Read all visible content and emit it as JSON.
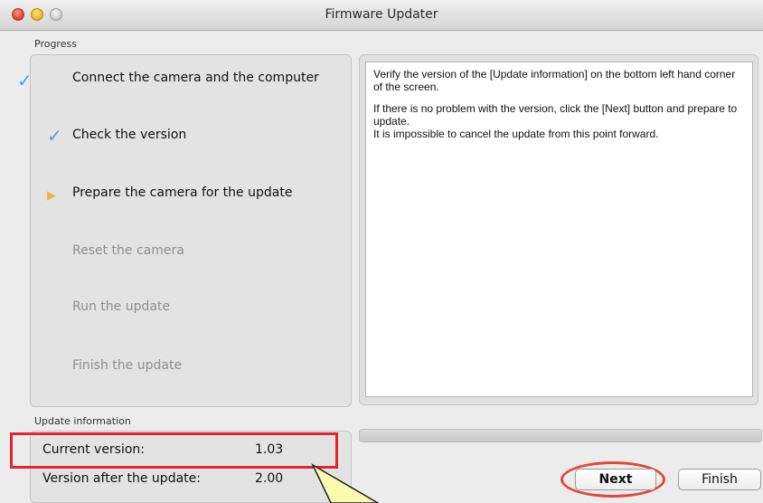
{
  "window": {
    "title": "Firmware Updater"
  },
  "progress": {
    "label": "Progress",
    "steps": [
      {
        "label": "Connect the camera and the computer",
        "state": "done",
        "icon": "check-icon"
      },
      {
        "label": "Check the version",
        "state": "done",
        "icon": "check-icon"
      },
      {
        "label": "Prepare the camera for the update",
        "state": "current",
        "icon": "triangle-right-icon"
      },
      {
        "label": "Reset the camera",
        "state": "pending"
      },
      {
        "label": "Run the update",
        "state": "pending"
      },
      {
        "label": "Finish the update",
        "state": "pending"
      }
    ]
  },
  "info": {
    "paragraph1": "Verify the version of the [Update information] on the bottom left hand corner of the screen.",
    "paragraph2_line1": "If there is no problem with the version, click the [Next] button and prepare to update.",
    "paragraph2_line2": "It is impossible to cancel the update from this point forward."
  },
  "update_information": {
    "label": "Update information",
    "current_version_label": "Current version:",
    "current_version_value": "1.03",
    "after_version_label": "Version after the update:",
    "after_version_value": "2.00"
  },
  "buttons": {
    "next": "Next",
    "finish": "Finish"
  },
  "colors": {
    "highlight": "#e1262c",
    "check": "#55a0d8",
    "current_arrow": "#f2b04a",
    "callout": "#fafab0"
  }
}
